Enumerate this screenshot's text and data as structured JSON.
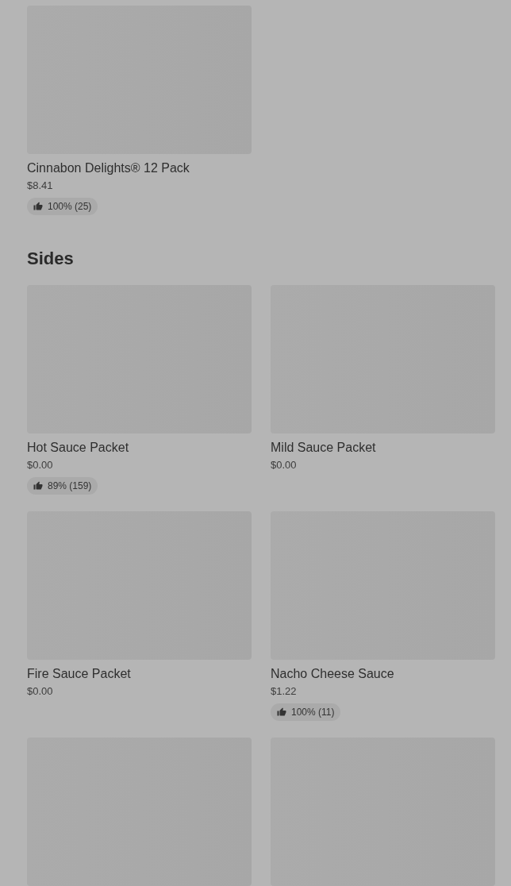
{
  "sections": [
    {
      "items": [
        {
          "kind": "dish",
          "name": "Cinnabon Delights® 12 Pack",
          "price": "$8.41",
          "rating": "100% (25)"
        }
      ]
    },
    {
      "title": "Sides",
      "items": [
        {
          "kind": "dish",
          "name": "Hot Sauce Packet",
          "price": "$0.00",
          "rating": "89% (159)"
        },
        {
          "kind": "dish",
          "name": "Mild Sauce Packet",
          "price": "$0.00"
        },
        {
          "kind": "dish",
          "name": "Fire Sauce Packet",
          "price": "$0.00"
        },
        {
          "kind": "dish",
          "name": "Nacho Cheese Sauce",
          "price": "$1.22",
          "rating": "100% (11)"
        },
        {
          "kind": "picture"
        },
        {
          "kind": "picture"
        }
      ]
    }
  ]
}
